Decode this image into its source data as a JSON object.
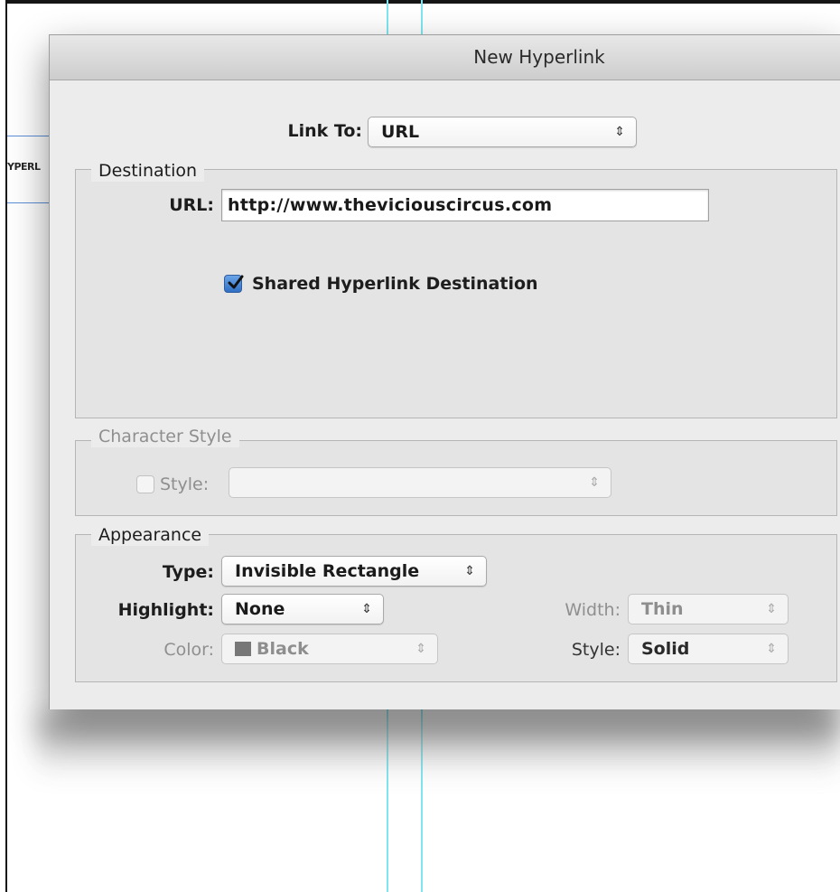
{
  "background": {
    "frame_text": "YPERL"
  },
  "dialog": {
    "title": "New Hyperlink",
    "link_to": {
      "label": "Link To:",
      "value": "URL"
    },
    "destination": {
      "group_title": "Destination",
      "url_label": "URL:",
      "url_value": "http://www.theviciouscircus.com",
      "shared_label": "Shared Hyperlink Destination",
      "shared_checked": true
    },
    "character_style": {
      "group_title": "Character Style",
      "style_label": "Style:",
      "style_checked": false,
      "style_value": ""
    },
    "appearance": {
      "group_title": "Appearance",
      "type_label": "Type:",
      "type_value": "Invisible Rectangle",
      "highlight_label": "Highlight:",
      "highlight_value": "None",
      "color_label": "Color:",
      "color_value": "Black",
      "color_swatch": "#777777",
      "width_label": "Width:",
      "width_value": "Thin",
      "style_label": "Style:",
      "style_value": "Solid"
    }
  },
  "icons": {
    "popup_arrows": "↕",
    "checkmark": "check-icon"
  },
  "colors": {
    "guide": "#7fe6f0",
    "frame": "#5b8fd8",
    "checkbox_accent": "#3d7fd6"
  }
}
